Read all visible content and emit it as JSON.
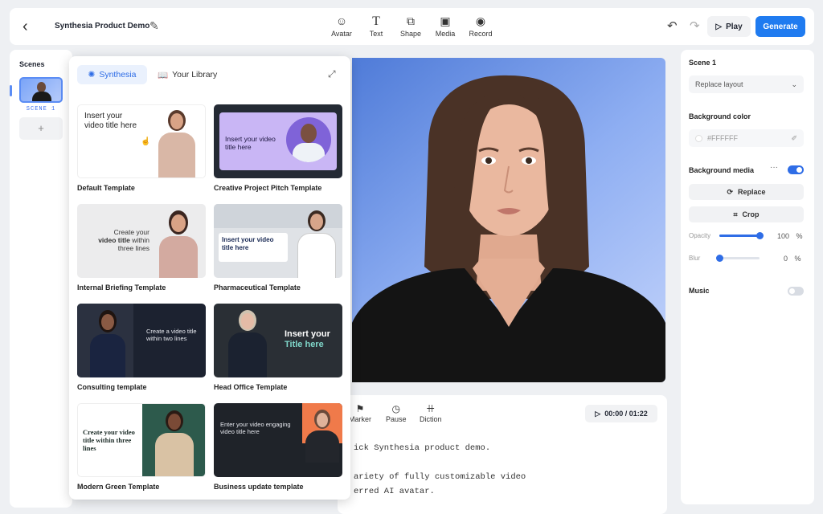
{
  "topbar": {
    "project_title": "Synthesia Product Demo",
    "tools": [
      {
        "label": "Avatar",
        "icon": "avatar-icon"
      },
      {
        "label": "Text",
        "icon": "text-icon"
      },
      {
        "label": "Shape",
        "icon": "shape-icon"
      },
      {
        "label": "Media",
        "icon": "media-icon"
      },
      {
        "label": "Record",
        "icon": "record-icon"
      }
    ],
    "play_label": "Play",
    "generate_label": "Generate"
  },
  "scenes": {
    "title": "Scenes",
    "items": [
      {
        "label": "SCENE 1"
      }
    ],
    "add_label": "+"
  },
  "template_panel": {
    "tabs": [
      {
        "label": "Synthesia",
        "active": true
      },
      {
        "label": "Your Library",
        "active": false
      }
    ],
    "templates": [
      {
        "name": "Default Template",
        "thumb_text": "Insert your video title here"
      },
      {
        "name": "Creative Project Pitch Template",
        "thumb_text": "Insert your video title here"
      },
      {
        "name": "Internal Briefing Template",
        "thumb_text_a": "Create your",
        "thumb_text_b": "video title",
        "thumb_text_c": "within three lines"
      },
      {
        "name": "Pharmaceutical Template",
        "thumb_text": "Insert your video title here"
      },
      {
        "name": "Consulting template",
        "thumb_text": "Create a video title within two lines"
      },
      {
        "name": "Head Office Template",
        "thumb_text_a": "Insert your",
        "thumb_text_b": "Title here"
      },
      {
        "name": "Modern Green Template",
        "thumb_text": "Create your video title within three lines"
      },
      {
        "name": "Business update template",
        "thumb_text": "Enter your video engaging video title here"
      }
    ]
  },
  "script": {
    "tools": [
      {
        "label": "Marker",
        "icon": "marker-icon"
      },
      {
        "label": "Pause",
        "icon": "pause-icon"
      },
      {
        "label": "Diction",
        "icon": "diction-icon"
      }
    ],
    "timer": "00:00 / 01:22",
    "lines": [
      "ick Synthesia product demo.",
      "",
      "ariety of fully customizable video",
      "erred AI avatar."
    ]
  },
  "properties": {
    "scene_title": "Scene 1",
    "layout_select": "Replace layout",
    "bg_color_label": "Background color",
    "bg_color_value": "#FFFFFF",
    "bg_media_label": "Background media",
    "bg_media_enabled": true,
    "replace_label": "Replace",
    "crop_label": "Crop",
    "opacity_label": "Opacity",
    "opacity_value": 100,
    "opacity_unit": "%",
    "blur_label": "Blur",
    "blur_value": 0,
    "blur_unit": "%",
    "music_label": "Music",
    "music_enabled": false
  },
  "colors": {
    "accent": "#1f7bf0",
    "toggle_on": "#2f6de6",
    "toggle_off": "#d8dce3"
  }
}
